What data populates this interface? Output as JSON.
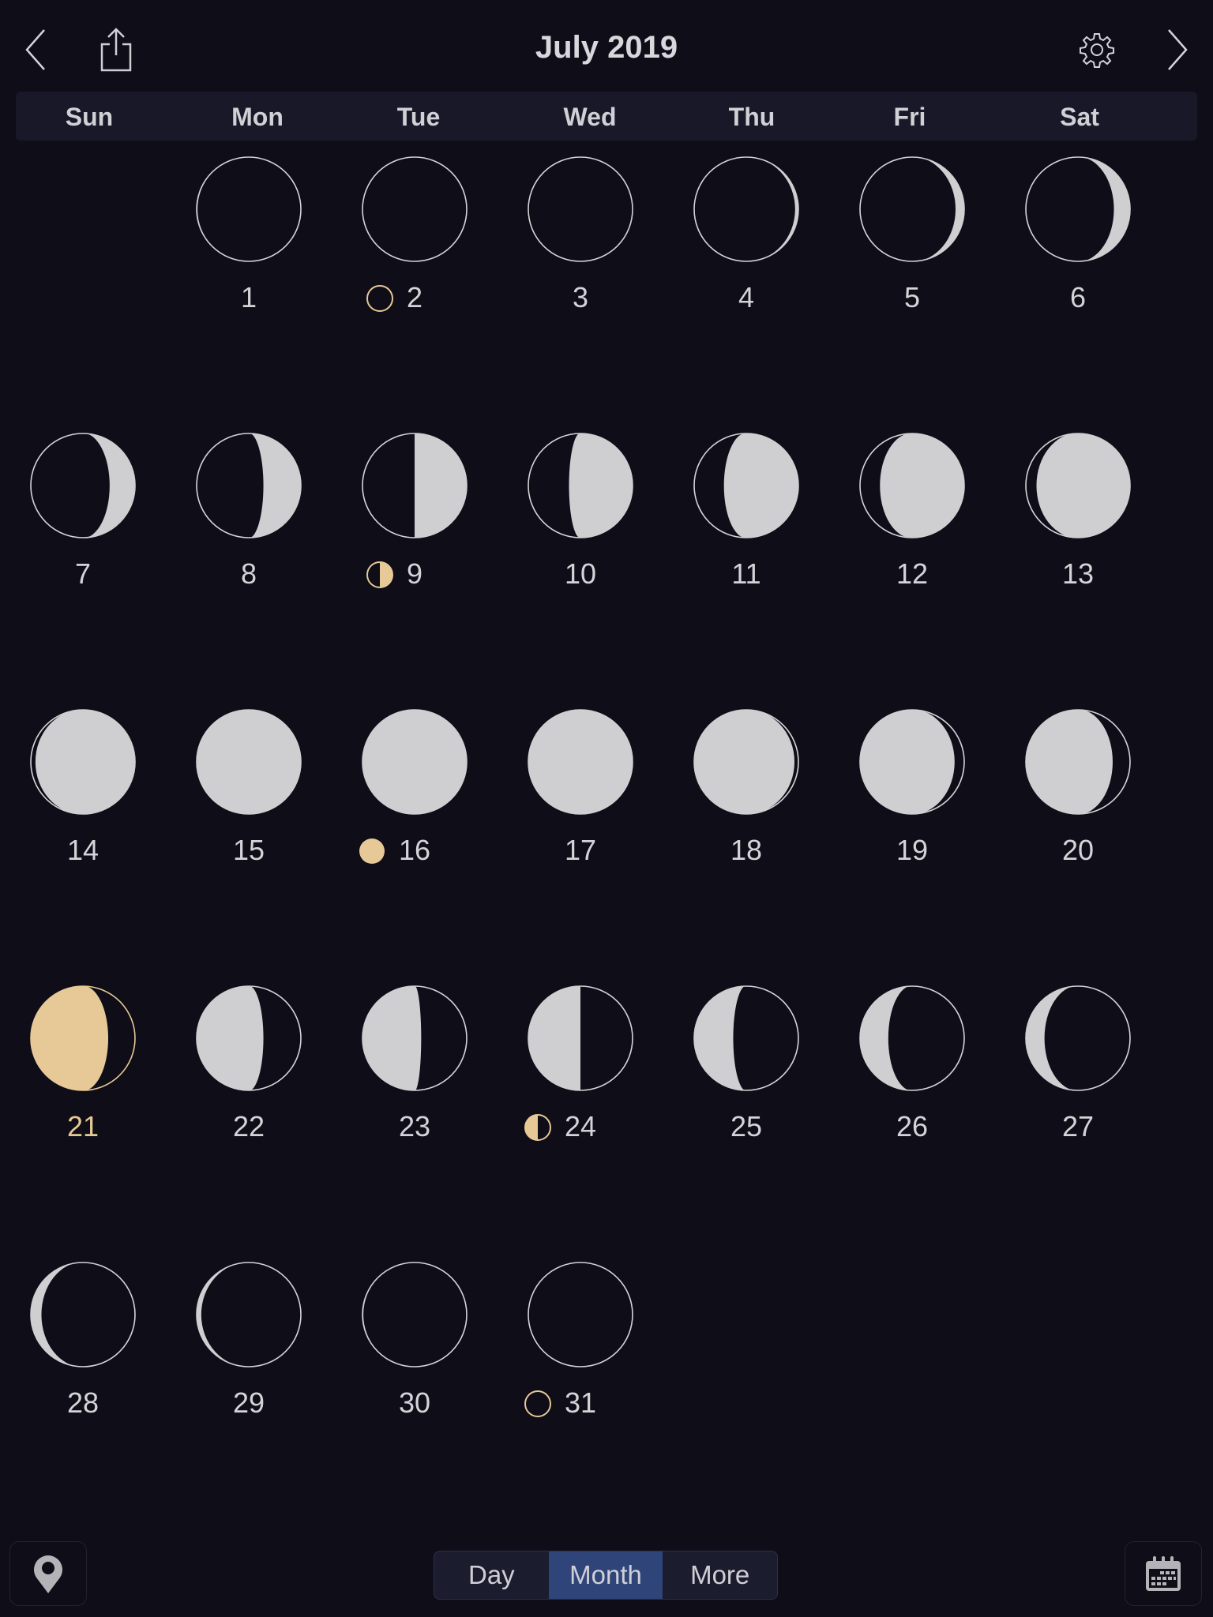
{
  "header": {
    "title": "July 2019",
    "prev_icon": "chevron-left-icon",
    "share_icon": "share-icon",
    "settings_icon": "gear-icon",
    "next_icon": "chevron-right-icon"
  },
  "weekdays": [
    "Sun",
    "Mon",
    "Tue",
    "Wed",
    "Thu",
    "Fri",
    "Sat"
  ],
  "colors": {
    "background": "#0e0d18",
    "moon_lit": "#cfcfd1",
    "moon_outline": "#d4d4d8",
    "highlight": "#e6c996",
    "segment_active": "#2f4478"
  },
  "calendar": {
    "first_weekday_index": 1,
    "today": 21,
    "days": [
      {
        "day": "1",
        "phase": 0.965
      },
      {
        "day": "2",
        "phase": 0.0,
        "marker": "new-moon"
      },
      {
        "day": "3",
        "phase": 0.025
      },
      {
        "day": "4",
        "phase": 0.06
      },
      {
        "day": "5",
        "phase": 0.095
      },
      {
        "day": "6",
        "phase": 0.13
      },
      {
        "day": "7",
        "phase": 0.165
      },
      {
        "day": "8",
        "phase": 0.205
      },
      {
        "day": "9",
        "phase": 0.25,
        "marker": "first-quarter"
      },
      {
        "day": "10",
        "phase": 0.285
      },
      {
        "day": "11",
        "phase": 0.32
      },
      {
        "day": "12",
        "phase": 0.355
      },
      {
        "day": "13",
        "phase": 0.395
      },
      {
        "day": "14",
        "phase": 0.43
      },
      {
        "day": "15",
        "phase": 0.47
      },
      {
        "day": "16",
        "phase": 0.5,
        "marker": "full-moon"
      },
      {
        "day": "17",
        "phase": 0.53
      },
      {
        "day": "18",
        "phase": 0.565
      },
      {
        "day": "19",
        "phase": 0.6
      },
      {
        "day": "20",
        "phase": 0.635
      },
      {
        "day": "21",
        "phase": 0.67
      },
      {
        "day": "22",
        "phase": 0.705
      },
      {
        "day": "23",
        "phase": 0.73
      },
      {
        "day": "24",
        "phase": 0.75,
        "marker": "last-quarter"
      },
      {
        "day": "25",
        "phase": 0.79
      },
      {
        "day": "26",
        "phase": 0.825
      },
      {
        "day": "27",
        "phase": 0.86
      },
      {
        "day": "28",
        "phase": 0.895
      },
      {
        "day": "29",
        "phase": 0.93
      },
      {
        "day": "30",
        "phase": 0.965
      },
      {
        "day": "31",
        "phase": 0.0,
        "marker": "new-moon"
      }
    ]
  },
  "bottom": {
    "location_icon": "map-pin-icon",
    "calendar_icon": "calendar-icon",
    "segments": [
      {
        "label": "Day",
        "active": false
      },
      {
        "label": "Month",
        "active": true
      },
      {
        "label": "More",
        "active": false
      }
    ]
  }
}
